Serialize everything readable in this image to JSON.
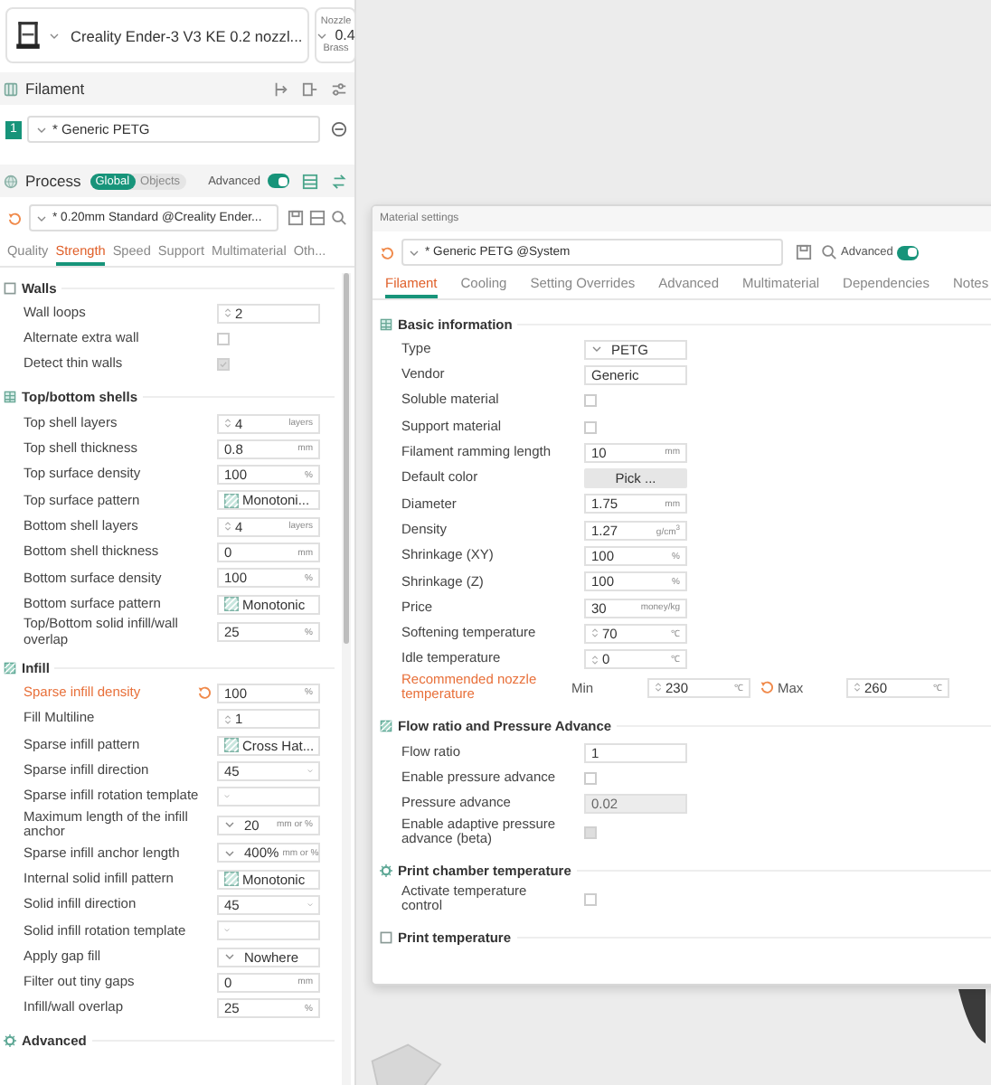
{
  "printer": {
    "name": "Creality Ender-3 V3 KE 0.2 nozzl...",
    "nozzle_label": "Nozzle",
    "nozzle_size": "0.4",
    "nozzle_type": "Brass"
  },
  "filament": {
    "title": "Filament",
    "slots": [
      {
        "number": "1",
        "name": "* Generic PETG"
      }
    ]
  },
  "process": {
    "title": "Process",
    "modes": [
      {
        "label": "Global",
        "selected": true
      },
      {
        "label": "Objects",
        "selected": false
      }
    ],
    "advanced_label": "Advanced",
    "advanced_on": true,
    "preset": "* 0.20mm Standard @Creality Ender...",
    "tabs": [
      {
        "label": "Quality",
        "selected": false
      },
      {
        "label": "Strength",
        "selected": true
      },
      {
        "label": "Speed",
        "selected": false
      },
      {
        "label": "Support",
        "selected": false
      },
      {
        "label": "Multimaterial",
        "selected": false
      },
      {
        "label": "Oth...",
        "selected": false
      }
    ],
    "sections": [
      {
        "title": "Walls",
        "rows": [
          {
            "label": "Wall loops",
            "kind": "spin",
            "value": "2"
          },
          {
            "label": "Alternate extra wall",
            "kind": "checkbox",
            "checked": false,
            "disabled": false
          },
          {
            "label": "Detect thin walls",
            "kind": "checkbox",
            "checked": true,
            "disabled": true
          }
        ]
      },
      {
        "title": "Top/bottom shells",
        "rows": [
          {
            "label": "Top shell layers",
            "kind": "spin",
            "value": "4",
            "unit": "layers"
          },
          {
            "label": "Top shell thickness",
            "kind": "input",
            "value": "0.8",
            "unit": "mm"
          },
          {
            "label": "Top surface density",
            "kind": "input",
            "value": "100",
            "unit": "%"
          },
          {
            "label": "Top surface pattern",
            "kind": "pattern",
            "value": "Monotoni..."
          },
          {
            "label": "Bottom shell layers",
            "kind": "spin",
            "value": "4",
            "unit": "layers"
          },
          {
            "label": "Bottom shell thickness",
            "kind": "input",
            "value": "0",
            "unit": "mm"
          },
          {
            "label": "Bottom surface density",
            "kind": "input",
            "value": "100",
            "unit": "%"
          },
          {
            "label": "Bottom surface pattern",
            "kind": "pattern",
            "value": "Monotonic"
          },
          {
            "label": "Top/Bottom solid infill/wall overlap",
            "kind": "input",
            "value": "25",
            "unit": "%"
          }
        ]
      },
      {
        "title": "Infill",
        "rows": [
          {
            "label": "Sparse infill density",
            "kind": "input",
            "value": "100",
            "unit": "%",
            "modified": true
          },
          {
            "label": "Fill Multiline",
            "kind": "spin",
            "value": "1"
          },
          {
            "label": "Sparse infill pattern",
            "kind": "pattern",
            "value": "Cross Hat..."
          },
          {
            "label": "Sparse infill direction",
            "kind": "select",
            "value": "45"
          },
          {
            "label": "Sparse infill rotation template",
            "kind": "select"
          },
          {
            "label": "Maximum length of the infill anchor",
            "kind": "combo",
            "value": "20",
            "unit": "mm or %"
          },
          {
            "label": "Sparse infill anchor length",
            "kind": "combo",
            "value": "400%",
            "unit": "mm or %"
          },
          {
            "label": "Internal solid infill pattern",
            "kind": "pattern",
            "value": "Monotonic"
          },
          {
            "label": "Solid infill direction",
            "kind": "select",
            "value": "45"
          },
          {
            "label": "Solid infill rotation template",
            "kind": "select"
          },
          {
            "label": "Apply gap fill",
            "kind": "combo",
            "value": "Nowhere"
          },
          {
            "label": "Filter out tiny gaps",
            "kind": "input",
            "value": "0",
            "unit": "mm"
          },
          {
            "label": "Infill/wall overlap",
            "kind": "input",
            "value": "25",
            "unit": "%"
          }
        ]
      },
      {
        "title": "Advanced"
      }
    ]
  },
  "dialog": {
    "title": "Material settings",
    "preset": "* Generic PETG @System",
    "advanced_label": "Advanced",
    "advanced_on": true,
    "tabs": [
      {
        "label": "Filament",
        "selected": true
      },
      {
        "label": "Cooling",
        "selected": false
      },
      {
        "label": "Setting Overrides",
        "selected": false
      },
      {
        "label": "Advanced",
        "selected": false
      },
      {
        "label": "Multimaterial",
        "selected": false
      },
      {
        "label": "Dependencies",
        "selected": false
      },
      {
        "label": "Notes",
        "selected": false
      }
    ],
    "sections": [
      {
        "title": "Basic information",
        "rows": [
          {
            "label": "Type",
            "kind": "combo",
            "value": "PETG"
          },
          {
            "label": "Vendor",
            "kind": "input",
            "value": "Generic"
          },
          {
            "label": "Soluble material",
            "kind": "checkbox",
            "checked": false,
            "disabled": false
          },
          {
            "label": "Support material",
            "kind": "checkbox",
            "checked": false,
            "disabled": false
          },
          {
            "label": "Filament ramming length",
            "kind": "input",
            "value": "10",
            "unit": "mm"
          },
          {
            "label": "Default color",
            "kind": "button",
            "value": "Pick ..."
          },
          {
            "label": "Diameter",
            "kind": "input",
            "value": "1.75",
            "unit": "mm"
          },
          {
            "label": "Density",
            "kind": "input",
            "value": "1.27",
            "unit": "g/cm$^{3}$"
          },
          {
            "label": "Shrinkage (XY)",
            "kind": "input",
            "value": "100",
            "unit": "%"
          },
          {
            "label": "Shrinkage (Z)",
            "kind": "input",
            "value": "100",
            "unit": "%"
          },
          {
            "label": "Price",
            "kind": "input",
            "value": "30",
            "unit": "money/kg"
          },
          {
            "label": "Softening temperature",
            "kind": "spin",
            "value": "70",
            "unit": "℃"
          },
          {
            "label": "Idle temperature",
            "kind": "spin",
            "value": "0",
            "unit": "℃"
          },
          {
            "label": "Recommended nozzle temperature",
            "kind": "range",
            "modified": true,
            "min_label": "Min",
            "min": "230",
            "max_label": "Max",
            "max": "260",
            "unit": "℃"
          }
        ]
      },
      {
        "title": "Flow ratio and Pressure Advance",
        "rows": [
          {
            "label": "Flow ratio",
            "kind": "input",
            "value": "1"
          },
          {
            "label": "Enable pressure advance",
            "kind": "checkbox",
            "checked": false,
            "disabled": false
          },
          {
            "label": "Pressure advance",
            "kind": "input",
            "value": "0.02",
            "disabled": true
          },
          {
            "label": "Enable adaptive pressure advance (beta)",
            "kind": "checkbox",
            "checked": false,
            "disabled": true
          }
        ]
      },
      {
        "title": "Print chamber temperature",
        "rows": [
          {
            "label": "Activate temperature control",
            "kind": "checkbox",
            "checked": false,
            "disabled": false
          }
        ]
      },
      {
        "title": "Print temperature"
      }
    ]
  }
}
